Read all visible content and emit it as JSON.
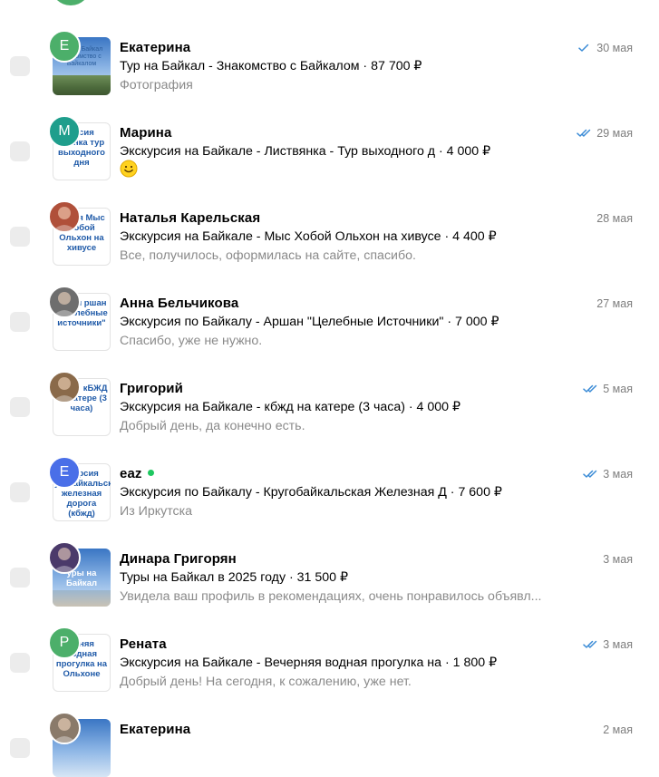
{
  "colors": {
    "tick_blue": "#3a8bd6",
    "online_green": "#1ec760",
    "secondary_text": "#8a8a8a",
    "date_text": "#7d7d7d"
  },
  "messages": [
    {
      "name": "Екатерина",
      "avatar_letter": "Е",
      "avatar_color": "#4caf6a",
      "subject": "Тур на Байкал - Знакомство с Байкалом · 87 700 ₽",
      "preview": "Фотография",
      "date": "30 мая",
      "ticks": "single",
      "thumb_text": "Тур на Байкал Знакомство с Байкалом"
    },
    {
      "name": "Марина",
      "avatar_letter": "М",
      "avatar_color": "#1f9e8c",
      "subject": "Экскурсия на Байкале - Листвянка - Тур выходного д · 4 000 ₽",
      "preview": "",
      "preview_icon": "smiley-emoji-icon",
      "date": "29 мая",
      "ticks": "double",
      "thumb_text": "урсия звянка тур выходного дня"
    },
    {
      "name": "Наталья Карельская",
      "avatar_letter": "",
      "avatar_color": "#b0503a",
      "subject": "Экскурсия на Байкале - Мыс Хобой Ольхон на хивусе · 4 400 ₽",
      "preview": "Все, получилось, оформилась на сайте, спасибо.",
      "date": "28 мая",
      "ticks": "none",
      "thumb_text": "урсия Мыс Хобой Ольхон на хивусе"
    },
    {
      "name": "Анна Бельчикова",
      "avatar_letter": "",
      "avatar_color": "#6e6e6e",
      "subject": "Экскурсия по Байкалу - Аршан \"Целебные Источники\" · 7 000 ₽",
      "preview": "Спасибо, уже не нужно.",
      "date": "27 мая",
      "ticks": "none",
      "thumb_text": "урсия ршан - \"целебные источники\""
    },
    {
      "name": "Григорий",
      "avatar_letter": "",
      "avatar_color": "#8a6a4a",
      "subject": "Экскурсия на Байкале - кбжд на катере (3 часа) · 4 000 ₽",
      "preview": "Добрый день, да конечно есть.",
      "date": "5 мая",
      "ticks": "double",
      "thumb_text": "урсия кБЖД на катере (3 часа)"
    },
    {
      "name": "eaz",
      "online": true,
      "avatar_letter": "Е",
      "avatar_color": "#4a6fe8",
      "subject": "Экскурсия по Байкалу - Кругобайкальская Железная Д · 7 600 ₽",
      "preview": "Из Иркутска",
      "date": "3 мая",
      "ticks": "double",
      "thumb_text": "скурсия угобайкальская железная дорога (кбжд)"
    },
    {
      "name": "Динара Григорян",
      "avatar_letter": "",
      "avatar_color": "#4b3a6a",
      "subject": "Туры на Байкал в 2025 году · 31 500 ₽",
      "preview": "Увидела ваш профиль в рекомендациях, очень понравилось объявл...",
      "date": "3 мая",
      "ticks": "none",
      "thumb_text": "уры на Байкал"
    },
    {
      "name": "Рената",
      "avatar_letter": "Р",
      "avatar_color": "#4caf6a",
      "subject": "Экскурсия на Байкале - Вечерняя водная прогулка на · 1 800 ₽",
      "preview": "Добрый день! На сегодня, к сожалению, уже нет.",
      "date": "3 мая",
      "ticks": "double",
      "thumb_text": "ерняя водная прогулка на Ольхоне"
    },
    {
      "name": "Екатерина",
      "avatar_letter": "",
      "avatar_color": "#8a7a6a",
      "subject": "",
      "preview": "",
      "date": "2 мая",
      "ticks": "none",
      "thumb_text": ""
    }
  ]
}
